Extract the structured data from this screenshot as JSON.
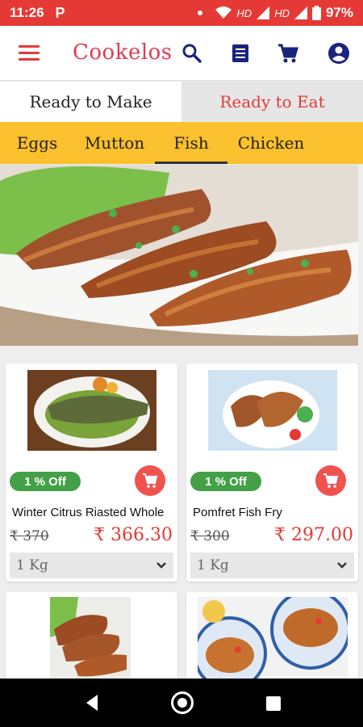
{
  "status_bar": {
    "time": "11:26",
    "app_icon": "P",
    "network": "HD",
    "network2": "HD",
    "battery": "97%"
  },
  "app_bar": {
    "brand": "Cookelos",
    "icons": [
      "menu-icon",
      "search-icon",
      "list-icon",
      "cart-icon",
      "account-icon"
    ]
  },
  "tabs": [
    {
      "label": "Ready to Make",
      "active": true
    },
    {
      "label": "Ready to Eat",
      "active": false
    }
  ],
  "categories": [
    {
      "label": "Eggs",
      "selected": false
    },
    {
      "label": "Mutton",
      "selected": false
    },
    {
      "label": "Fish",
      "selected": true
    },
    {
      "label": "Chicken",
      "selected": false
    }
  ],
  "products": [
    {
      "name": "Winter Citrus Riasted Whole",
      "discount": "1 % Off",
      "old_price": "₹ 370",
      "new_price": "₹ 366.30",
      "unit": "1 Kg"
    },
    {
      "name": "Pomfret Fish Fry",
      "discount": "1 % Off",
      "old_price": "₹ 300",
      "new_price": "₹ 297.00",
      "unit": "1 Kg"
    }
  ],
  "colors": {
    "primary_red": "#e53935",
    "category_yellow": "#fbc02d",
    "discount_green": "#43a047"
  }
}
